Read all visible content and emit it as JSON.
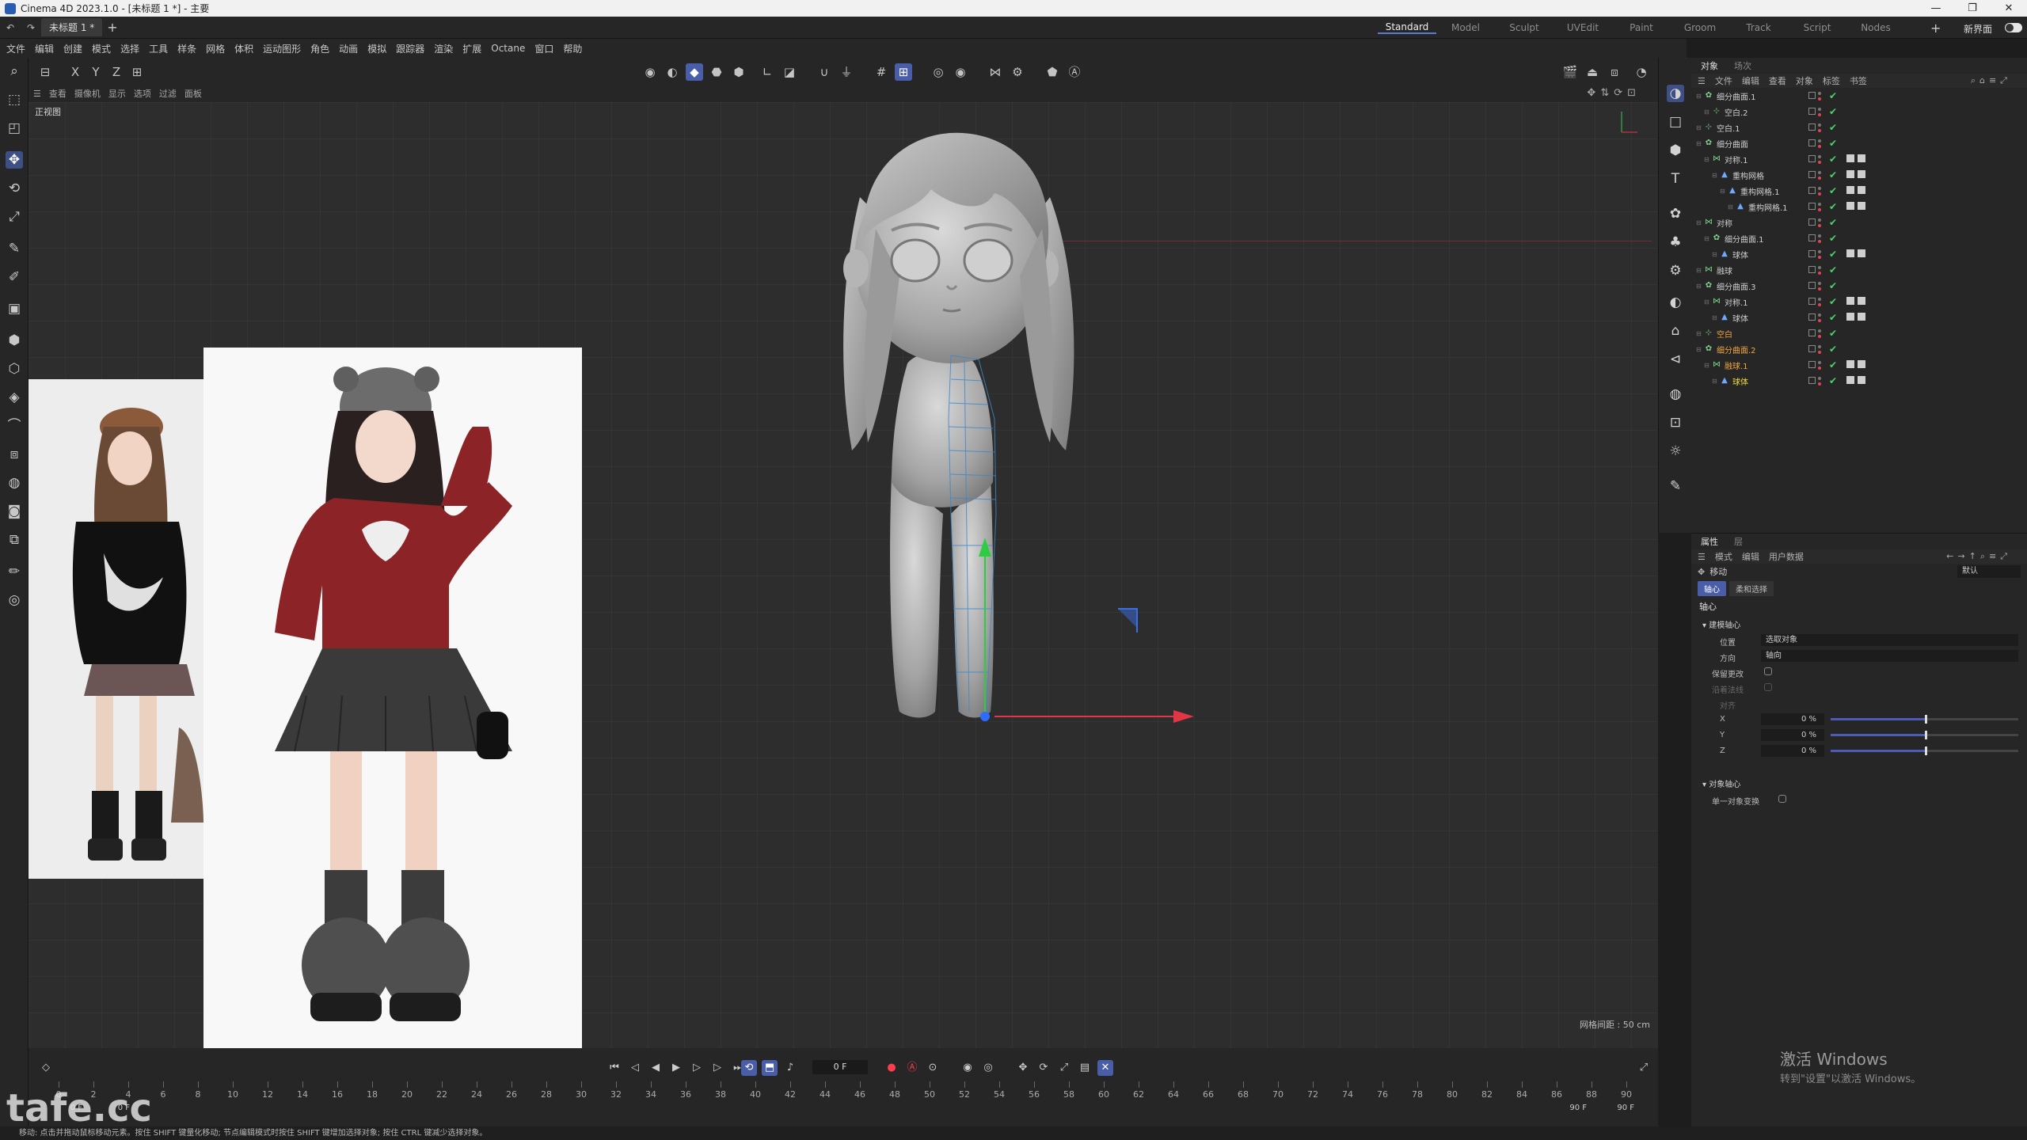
{
  "window": {
    "title": "Cinema 4D 2023.1.0 - [未标题 1 *] - 主要",
    "controls": [
      "—",
      "❐",
      "✕"
    ]
  },
  "tabs": {
    "document": "未标题 1 *",
    "add": "+",
    "layouts": [
      "Standard",
      "Model",
      "Sculpt",
      "UVEdit",
      "Paint",
      "Groom",
      "Track",
      "Script",
      "Nodes"
    ],
    "active_layout": "Standard",
    "new_ui": "新界面"
  },
  "menu": [
    "文件",
    "编辑",
    "创建",
    "模式",
    "选择",
    "工具",
    "样条",
    "网格",
    "体积",
    "运动图形",
    "角色",
    "动画",
    "模拟",
    "跟踪器",
    "渲染",
    "扩展",
    "Octane",
    "窗口",
    "帮助"
  ],
  "axis_toggles": [
    "X",
    "Y",
    "Z"
  ],
  "viewport": {
    "menu": [
      "查看",
      "摄像机",
      "显示",
      "选项",
      "过滤",
      "面板"
    ],
    "label": "正视图",
    "grid_spacing": "网格间距 : 50 cm"
  },
  "timeline": {
    "current_frame": "0 F",
    "start_frame": "0 F",
    "start_frame2": "0 F",
    "end_frame": "90 F",
    "end_frame2": "90 F",
    "ticks": [
      "0",
      "2",
      "4",
      "6",
      "8",
      "10",
      "12",
      "14",
      "16",
      "18",
      "20",
      "22",
      "24",
      "26",
      "28",
      "30",
      "32",
      "34",
      "36",
      "38",
      "40",
      "42",
      "44",
      "46",
      "48",
      "50",
      "52",
      "54",
      "56",
      "58",
      "60",
      "62",
      "64",
      "66",
      "68",
      "70",
      "72",
      "74",
      "76",
      "78",
      "80",
      "82",
      "84",
      "86",
      "88",
      "90"
    ]
  },
  "status": "移动: 点击并拖动鼠标移动元素。按住 SHIFT 键量化移动; 节点编辑模式时按住 SHIFT 键增加选择对象; 按住 CTRL 键减少选择对象。",
  "object_manager": {
    "tabs": [
      "对象",
      "场次"
    ],
    "menu": [
      "文件",
      "编辑",
      "查看",
      "对象",
      "标签",
      "书签"
    ],
    "rows": [
      {
        "name": "细分曲面.1",
        "depth": 0,
        "icon": "✿",
        "color": "normal"
      },
      {
        "name": "空白.2",
        "depth": 1,
        "icon": "⊹",
        "color": "normal"
      },
      {
        "name": "空白.1",
        "depth": 0,
        "icon": "⊹",
        "color": "normal"
      },
      {
        "name": "细分曲面",
        "depth": 0,
        "icon": "✿",
        "color": "normal"
      },
      {
        "name": "对称.1",
        "depth": 1,
        "icon": "⋈",
        "color": "normal"
      },
      {
        "name": "重构网格",
        "depth": 2,
        "icon": "▲",
        "color": "normal"
      },
      {
        "name": "重构网格.1",
        "depth": 3,
        "icon": "▲",
        "color": "normal"
      },
      {
        "name": "重构网格.1",
        "depth": 4,
        "icon": "▲",
        "color": "normal"
      },
      {
        "name": "对称",
        "depth": 0,
        "icon": "⋈",
        "color": "normal"
      },
      {
        "name": "细分曲面.1",
        "depth": 1,
        "icon": "✿",
        "color": "normal"
      },
      {
        "name": "球体",
        "depth": 2,
        "icon": "▲",
        "color": "normal"
      },
      {
        "name": "融球",
        "depth": 0,
        "icon": "⋈",
        "color": "normal"
      },
      {
        "name": "细分曲面.3",
        "depth": 0,
        "icon": "✿",
        "color": "normal"
      },
      {
        "name": "对称.1",
        "depth": 1,
        "icon": "⋈",
        "color": "normal"
      },
      {
        "name": "球体",
        "depth": 2,
        "icon": "▲",
        "color": "normal"
      },
      {
        "name": "空白",
        "depth": 0,
        "icon": "⊹",
        "color": "orange"
      },
      {
        "name": "细分曲面.2",
        "depth": 0,
        "icon": "✿",
        "color": "orange"
      },
      {
        "name": "融球.1",
        "depth": 1,
        "icon": "⋈",
        "color": "orange"
      },
      {
        "name": "球体",
        "depth": 2,
        "icon": "▲",
        "color": "yellow"
      }
    ]
  },
  "attributes": {
    "tabs": [
      "属性",
      "层"
    ],
    "menu": [
      "模式",
      "编辑",
      "用户数据"
    ],
    "tool_name": "移动",
    "preset": "默认",
    "subtabs": [
      "轴心",
      "柔和选择"
    ],
    "section": "轴心",
    "group1": "建模轴心",
    "position_label": "位置",
    "position_value": "选取对象",
    "orientation_label": "方向",
    "orientation_value": "轴向",
    "keep_changes": "保留更改",
    "along_normal": "沿着法线",
    "align": "对齐",
    "x_label": "X",
    "x_value": "0 %",
    "x_level": 0.5,
    "y_label": "Y",
    "y_value": "0 %",
    "y_level": 0.5,
    "z_label": "Z",
    "z_value": "0 %",
    "z_level": 0.5,
    "group2": "对象轴心",
    "single_object": "单一对象变换"
  },
  "watermark": {
    "title": "激活 Windows",
    "subtitle": "转到\"设置\"以激活 Windows。",
    "logo": "tafe.cc"
  },
  "colors": {
    "accent": "#4a5da8",
    "x_axis": "#e23646",
    "y_axis": "#2ecc40",
    "z_axis": "#2f6bff",
    "check": "#4ed36d"
  }
}
